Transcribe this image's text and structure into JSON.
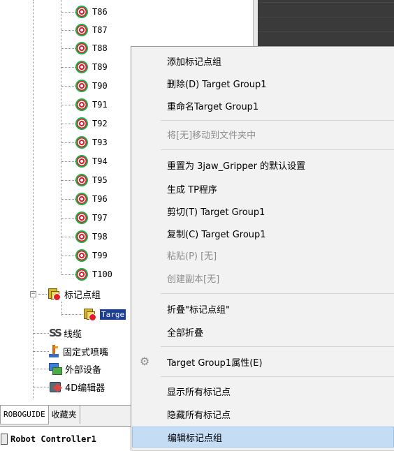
{
  "tree": {
    "targets": [
      "T86",
      "T87",
      "T88",
      "T89",
      "T90",
      "T91",
      "T92",
      "T93",
      "T94",
      "T95",
      "T96",
      "T97",
      "T98",
      "T99",
      "T100"
    ],
    "group_label": "标记点组",
    "selected_item_label": "Targe",
    "cables_label": "线缆",
    "fixed_dispenser_label": "固定式喷嘴",
    "external_device_label": "外部设备",
    "editor_4d_label": "4D编辑器"
  },
  "tabs": {
    "roboguide": "ROBOGUIDE",
    "favorites": "收藏夹"
  },
  "bottom_panel": {
    "label": "Robot Controller1"
  },
  "context_menu": {
    "items": [
      {
        "label": "添加标记点组",
        "enabled": true
      },
      {
        "label": "删除(D) Target Group1",
        "enabled": true
      },
      {
        "label": "重命名Target Group1",
        "enabled": true
      },
      {
        "label": "将[无]移动到文件夹中",
        "enabled": false
      },
      {
        "label": "重置为 3jaw_Gripper 的默认设置",
        "enabled": true
      },
      {
        "label": "生成 TP程序",
        "enabled": true
      },
      {
        "label": "剪切(T) Target Group1",
        "enabled": true
      },
      {
        "label": "复制(C) Target Group1",
        "enabled": true
      },
      {
        "label": "粘贴(P) [无]",
        "enabled": false
      },
      {
        "label": "创建副本[无]",
        "enabled": false
      },
      {
        "label": "折叠\"标记点组\"",
        "enabled": true
      },
      {
        "label": "全部折叠",
        "enabled": true
      },
      {
        "label": "Target Group1属性(E)",
        "enabled": true
      },
      {
        "label": "显示所有标记点",
        "enabled": true
      },
      {
        "label": "隐藏所有标记点",
        "enabled": true
      },
      {
        "label": "编辑标记点组",
        "enabled": true
      }
    ],
    "highlighted_index": 15
  },
  "colors": {
    "selection_bg": "#1d3e95",
    "menu_highlight": "#c5dcf5",
    "disabled_text": "#8d8d8d"
  }
}
